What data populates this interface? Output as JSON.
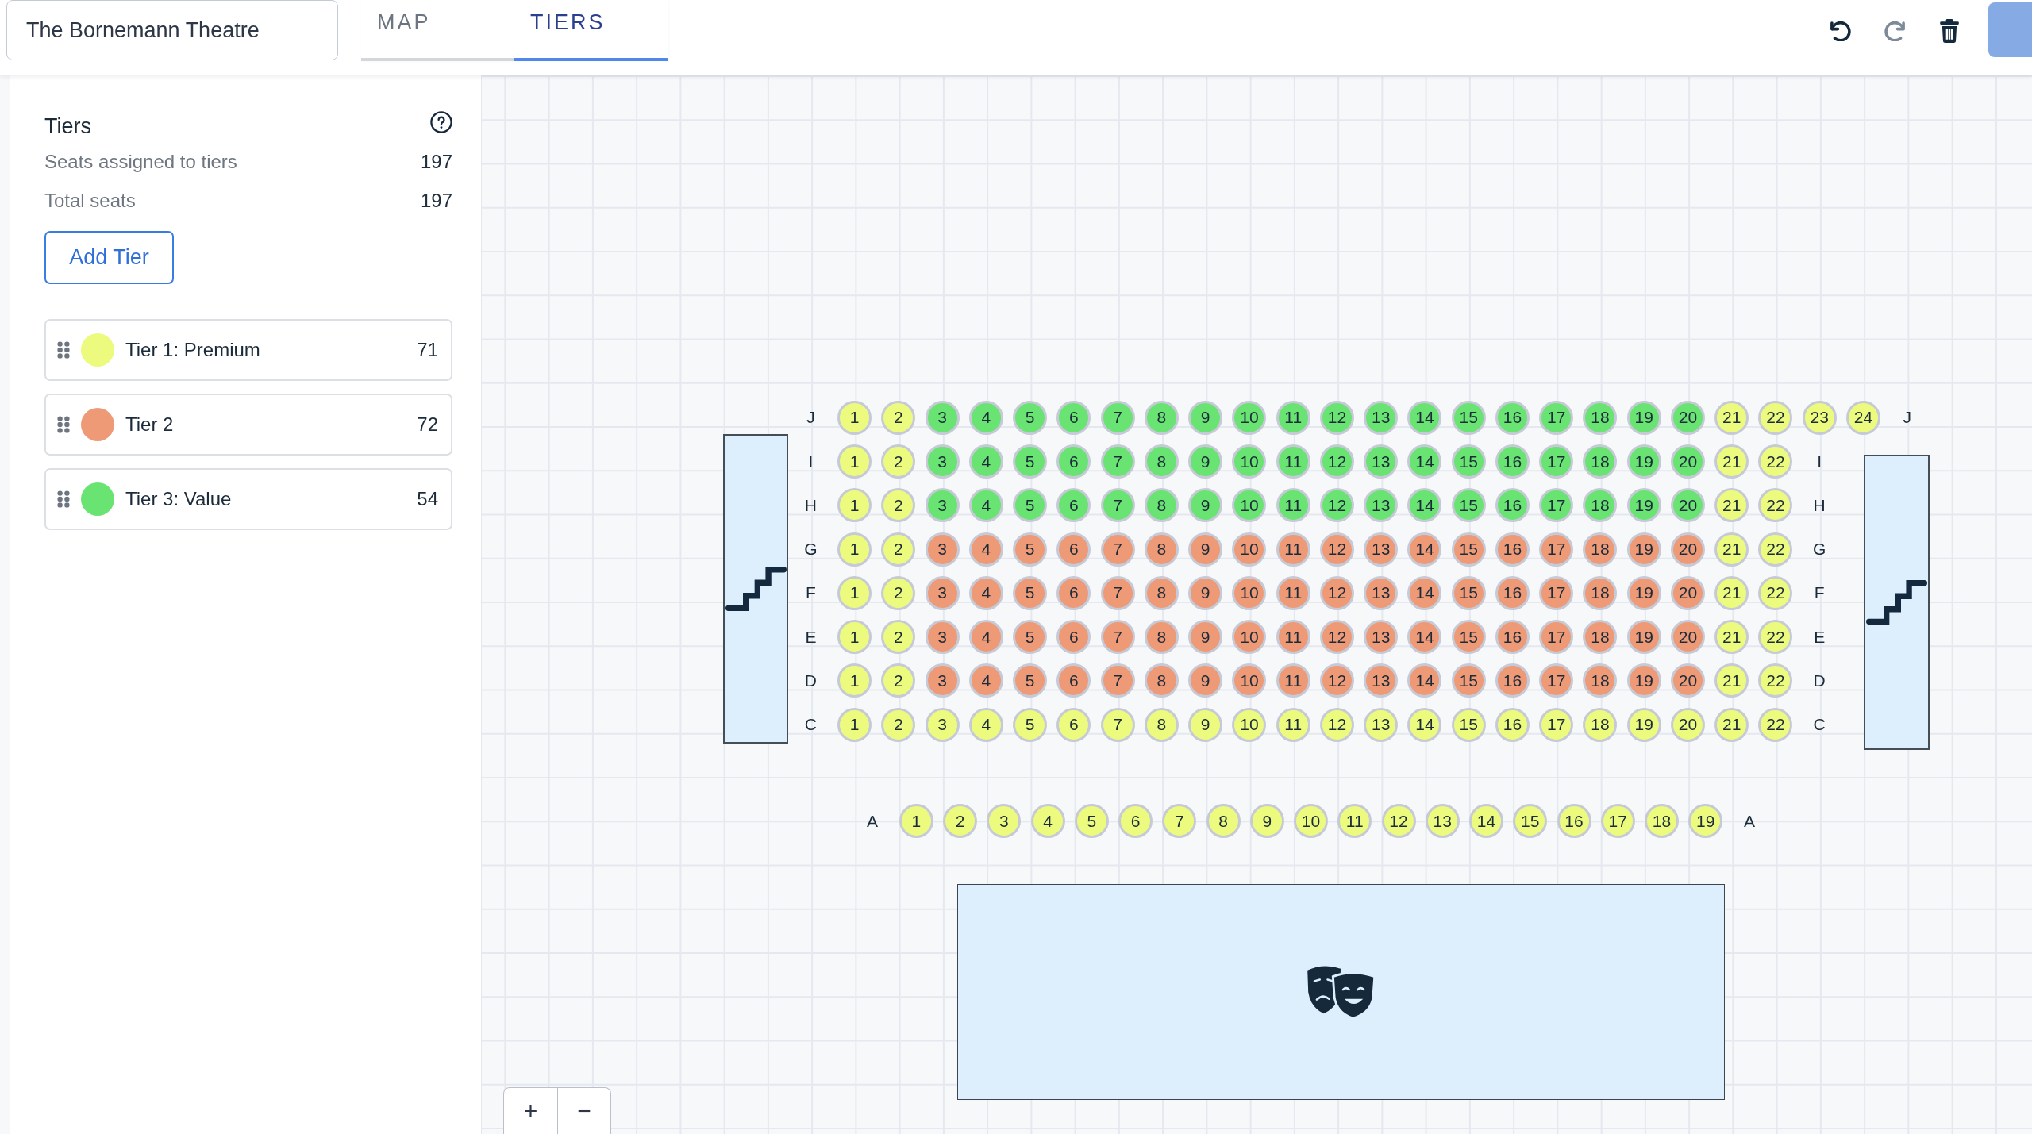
{
  "header": {
    "venue_name": "The Bornemann Theatre",
    "tabs": [
      {
        "label": "MAP",
        "selected": false
      },
      {
        "label": "TIERS",
        "selected": true
      }
    ]
  },
  "toolbar": [
    {
      "kind": "undo",
      "disabled": false
    },
    {
      "kind": "redo",
      "disabled": true
    },
    {
      "kind": "delete",
      "disabled": false
    }
  ],
  "tiers_panel": {
    "title": "Tiers",
    "stats": [
      {
        "label": "Seats assigned to tiers",
        "value": "197"
      },
      {
        "label": "Total seats",
        "value": "197"
      }
    ],
    "add_button": "Add Tier",
    "tiers": [
      {
        "name": "Tier 1: Premium",
        "count": "71",
        "color": "#ecfb7e"
      },
      {
        "name": "Tier 2",
        "count": "72",
        "color": "#ef9a77"
      },
      {
        "name": "Tier 3: Value",
        "count": "54",
        "color": "#69e372"
      }
    ]
  },
  "seat_map": {
    "rows": [
      {
        "label_left": "J",
        "label_right": "J",
        "seats": [
          {
            "number": "1",
            "color": "#ecfb7e"
          },
          {
            "number": "2",
            "color": "#ecfb7e"
          },
          {
            "number": "3",
            "color": "#69e372"
          },
          {
            "number": "4",
            "color": "#69e372"
          },
          {
            "number": "5",
            "color": "#69e372"
          },
          {
            "number": "6",
            "color": "#69e372"
          },
          {
            "number": "7",
            "color": "#69e372"
          },
          {
            "number": "8",
            "color": "#69e372"
          },
          {
            "number": "9",
            "color": "#69e372"
          },
          {
            "number": "10",
            "color": "#69e372"
          },
          {
            "number": "11",
            "color": "#69e372"
          },
          {
            "number": "12",
            "color": "#69e372"
          },
          {
            "number": "13",
            "color": "#69e372"
          },
          {
            "number": "14",
            "color": "#69e372"
          },
          {
            "number": "15",
            "color": "#69e372"
          },
          {
            "number": "16",
            "color": "#69e372"
          },
          {
            "number": "17",
            "color": "#69e372"
          },
          {
            "number": "18",
            "color": "#69e372"
          },
          {
            "number": "19",
            "color": "#69e372"
          },
          {
            "number": "20",
            "color": "#69e372"
          },
          {
            "number": "21",
            "color": "#ecfb7e"
          },
          {
            "number": "22",
            "color": "#ecfb7e"
          },
          {
            "number": "23",
            "color": "#ecfb7e"
          },
          {
            "number": "24",
            "color": "#ecfb7e"
          }
        ]
      },
      {
        "label_left": "I",
        "label_right": "I",
        "seats": [
          {
            "number": "1",
            "color": "#ecfb7e"
          },
          {
            "number": "2",
            "color": "#ecfb7e"
          },
          {
            "number": "3",
            "color": "#69e372"
          },
          {
            "number": "4",
            "color": "#69e372"
          },
          {
            "number": "5",
            "color": "#69e372"
          },
          {
            "number": "6",
            "color": "#69e372"
          },
          {
            "number": "7",
            "color": "#69e372"
          },
          {
            "number": "8",
            "color": "#69e372"
          },
          {
            "number": "9",
            "color": "#69e372"
          },
          {
            "number": "10",
            "color": "#69e372"
          },
          {
            "number": "11",
            "color": "#69e372"
          },
          {
            "number": "12",
            "color": "#69e372"
          },
          {
            "number": "13",
            "color": "#69e372"
          },
          {
            "number": "14",
            "color": "#69e372"
          },
          {
            "number": "15",
            "color": "#69e372"
          },
          {
            "number": "16",
            "color": "#69e372"
          },
          {
            "number": "17",
            "color": "#69e372"
          },
          {
            "number": "18",
            "color": "#69e372"
          },
          {
            "number": "19",
            "color": "#69e372"
          },
          {
            "number": "20",
            "color": "#69e372"
          },
          {
            "number": "21",
            "color": "#ecfb7e"
          },
          {
            "number": "22",
            "color": "#ecfb7e"
          }
        ]
      },
      {
        "label_left": "H",
        "label_right": "H",
        "seats": [
          {
            "number": "1",
            "color": "#ecfb7e"
          },
          {
            "number": "2",
            "color": "#ecfb7e"
          },
          {
            "number": "3",
            "color": "#69e372"
          },
          {
            "number": "4",
            "color": "#69e372"
          },
          {
            "number": "5",
            "color": "#69e372"
          },
          {
            "number": "6",
            "color": "#69e372"
          },
          {
            "number": "7",
            "color": "#69e372"
          },
          {
            "number": "8",
            "color": "#69e372"
          },
          {
            "number": "9",
            "color": "#69e372"
          },
          {
            "number": "10",
            "color": "#69e372"
          },
          {
            "number": "11",
            "color": "#69e372"
          },
          {
            "number": "12",
            "color": "#69e372"
          },
          {
            "number": "13",
            "color": "#69e372"
          },
          {
            "number": "14",
            "color": "#69e372"
          },
          {
            "number": "15",
            "color": "#69e372"
          },
          {
            "number": "16",
            "color": "#69e372"
          },
          {
            "number": "17",
            "color": "#69e372"
          },
          {
            "number": "18",
            "color": "#69e372"
          },
          {
            "number": "19",
            "color": "#69e372"
          },
          {
            "number": "20",
            "color": "#69e372"
          },
          {
            "number": "21",
            "color": "#ecfb7e"
          },
          {
            "number": "22",
            "color": "#ecfb7e"
          }
        ]
      },
      {
        "label_left": "G",
        "label_right": "G",
        "seats": [
          {
            "number": "1",
            "color": "#ecfb7e"
          },
          {
            "number": "2",
            "color": "#ecfb7e"
          },
          {
            "number": "3",
            "color": "#ef9a77"
          },
          {
            "number": "4",
            "color": "#ef9a77"
          },
          {
            "number": "5",
            "color": "#ef9a77"
          },
          {
            "number": "6",
            "color": "#ef9a77"
          },
          {
            "number": "7",
            "color": "#ef9a77"
          },
          {
            "number": "8",
            "color": "#ef9a77"
          },
          {
            "number": "9",
            "color": "#ef9a77"
          },
          {
            "number": "10",
            "color": "#ef9a77"
          },
          {
            "number": "11",
            "color": "#ef9a77"
          },
          {
            "number": "12",
            "color": "#ef9a77"
          },
          {
            "number": "13",
            "color": "#ef9a77"
          },
          {
            "number": "14",
            "color": "#ef9a77"
          },
          {
            "number": "15",
            "color": "#ef9a77"
          },
          {
            "number": "16",
            "color": "#ef9a77"
          },
          {
            "number": "17",
            "color": "#ef9a77"
          },
          {
            "number": "18",
            "color": "#ef9a77"
          },
          {
            "number": "19",
            "color": "#ef9a77"
          },
          {
            "number": "20",
            "color": "#ef9a77"
          },
          {
            "number": "21",
            "color": "#ecfb7e"
          },
          {
            "number": "22",
            "color": "#ecfb7e"
          }
        ]
      },
      {
        "label_left": "F",
        "label_right": "F",
        "seats": [
          {
            "number": "1",
            "color": "#ecfb7e"
          },
          {
            "number": "2",
            "color": "#ecfb7e"
          },
          {
            "number": "3",
            "color": "#ef9a77"
          },
          {
            "number": "4",
            "color": "#ef9a77"
          },
          {
            "number": "5",
            "color": "#ef9a77"
          },
          {
            "number": "6",
            "color": "#ef9a77"
          },
          {
            "number": "7",
            "color": "#ef9a77"
          },
          {
            "number": "8",
            "color": "#ef9a77"
          },
          {
            "number": "9",
            "color": "#ef9a77"
          },
          {
            "number": "10",
            "color": "#ef9a77"
          },
          {
            "number": "11",
            "color": "#ef9a77"
          },
          {
            "number": "12",
            "color": "#ef9a77"
          },
          {
            "number": "13",
            "color": "#ef9a77"
          },
          {
            "number": "14",
            "color": "#ef9a77"
          },
          {
            "number": "15",
            "color": "#ef9a77"
          },
          {
            "number": "16",
            "color": "#ef9a77"
          },
          {
            "number": "17",
            "color": "#ef9a77"
          },
          {
            "number": "18",
            "color": "#ef9a77"
          },
          {
            "number": "19",
            "color": "#ef9a77"
          },
          {
            "number": "20",
            "color": "#ef9a77"
          },
          {
            "number": "21",
            "color": "#ecfb7e"
          },
          {
            "number": "22",
            "color": "#ecfb7e"
          }
        ]
      },
      {
        "label_left": "E",
        "label_right": "E",
        "seats": [
          {
            "number": "1",
            "color": "#ecfb7e"
          },
          {
            "number": "2",
            "color": "#ecfb7e"
          },
          {
            "number": "3",
            "color": "#ef9a77"
          },
          {
            "number": "4",
            "color": "#ef9a77"
          },
          {
            "number": "5",
            "color": "#ef9a77"
          },
          {
            "number": "6",
            "color": "#ef9a77"
          },
          {
            "number": "7",
            "color": "#ef9a77"
          },
          {
            "number": "8",
            "color": "#ef9a77"
          },
          {
            "number": "9",
            "color": "#ef9a77"
          },
          {
            "number": "10",
            "color": "#ef9a77"
          },
          {
            "number": "11",
            "color": "#ef9a77"
          },
          {
            "number": "12",
            "color": "#ef9a77"
          },
          {
            "number": "13",
            "color": "#ef9a77"
          },
          {
            "number": "14",
            "color": "#ef9a77"
          },
          {
            "number": "15",
            "color": "#ef9a77"
          },
          {
            "number": "16",
            "color": "#ef9a77"
          },
          {
            "number": "17",
            "color": "#ef9a77"
          },
          {
            "number": "18",
            "color": "#ef9a77"
          },
          {
            "number": "19",
            "color": "#ef9a77"
          },
          {
            "number": "20",
            "color": "#ef9a77"
          },
          {
            "number": "21",
            "color": "#ecfb7e"
          },
          {
            "number": "22",
            "color": "#ecfb7e"
          }
        ]
      },
      {
        "label_left": "D",
        "label_right": "D",
        "seats": [
          {
            "number": "1",
            "color": "#ecfb7e"
          },
          {
            "number": "2",
            "color": "#ecfb7e"
          },
          {
            "number": "3",
            "color": "#ef9a77"
          },
          {
            "number": "4",
            "color": "#ef9a77"
          },
          {
            "number": "5",
            "color": "#ef9a77"
          },
          {
            "number": "6",
            "color": "#ef9a77"
          },
          {
            "number": "7",
            "color": "#ef9a77"
          },
          {
            "number": "8",
            "color": "#ef9a77"
          },
          {
            "number": "9",
            "color": "#ef9a77"
          },
          {
            "number": "10",
            "color": "#ef9a77"
          },
          {
            "number": "11",
            "color": "#ef9a77"
          },
          {
            "number": "12",
            "color": "#ef9a77"
          },
          {
            "number": "13",
            "color": "#ef9a77"
          },
          {
            "number": "14",
            "color": "#ef9a77"
          },
          {
            "number": "15",
            "color": "#ef9a77"
          },
          {
            "number": "16",
            "color": "#ef9a77"
          },
          {
            "number": "17",
            "color": "#ef9a77"
          },
          {
            "number": "18",
            "color": "#ef9a77"
          },
          {
            "number": "19",
            "color": "#ef9a77"
          },
          {
            "number": "20",
            "color": "#ef9a77"
          },
          {
            "number": "21",
            "color": "#ecfb7e"
          },
          {
            "number": "22",
            "color": "#ecfb7e"
          }
        ]
      },
      {
        "label_left": "C",
        "label_right": "C",
        "seats": [
          {
            "number": "1",
            "color": "#ecfb7e"
          },
          {
            "number": "2",
            "color": "#ecfb7e"
          },
          {
            "number": "3",
            "color": "#ecfb7e"
          },
          {
            "number": "4",
            "color": "#ecfb7e"
          },
          {
            "number": "5",
            "color": "#ecfb7e"
          },
          {
            "number": "6",
            "color": "#ecfb7e"
          },
          {
            "number": "7",
            "color": "#ecfb7e"
          },
          {
            "number": "8",
            "color": "#ecfb7e"
          },
          {
            "number": "9",
            "color": "#ecfb7e"
          },
          {
            "number": "10",
            "color": "#ecfb7e"
          },
          {
            "number": "11",
            "color": "#ecfb7e"
          },
          {
            "number": "12",
            "color": "#ecfb7e"
          },
          {
            "number": "13",
            "color": "#ecfb7e"
          },
          {
            "number": "14",
            "color": "#ecfb7e"
          },
          {
            "number": "15",
            "color": "#ecfb7e"
          },
          {
            "number": "16",
            "color": "#ecfb7e"
          },
          {
            "number": "17",
            "color": "#ecfb7e"
          },
          {
            "number": "18",
            "color": "#ecfb7e"
          },
          {
            "number": "19",
            "color": "#ecfb7e"
          },
          {
            "number": "20",
            "color": "#ecfb7e"
          },
          {
            "number": "21",
            "color": "#ecfb7e"
          },
          {
            "number": "22",
            "color": "#ecfb7e"
          }
        ]
      }
    ],
    "front_rows": [
      {
        "label_left": "A",
        "label_right": "A",
        "seats": [
          {
            "number": "1",
            "color": "#ecfb7e"
          },
          {
            "number": "2",
            "color": "#ecfb7e"
          },
          {
            "number": "3",
            "color": "#ecfb7e"
          },
          {
            "number": "4",
            "color": "#ecfb7e"
          },
          {
            "number": "5",
            "color": "#ecfb7e"
          },
          {
            "number": "6",
            "color": "#ecfb7e"
          },
          {
            "number": "7",
            "color": "#ecfb7e"
          },
          {
            "number": "8",
            "color": "#ecfb7e"
          },
          {
            "number": "9",
            "color": "#ecfb7e"
          },
          {
            "number": "10",
            "color": "#ecfb7e"
          },
          {
            "number": "11",
            "color": "#ecfb7e"
          },
          {
            "number": "12",
            "color": "#ecfb7e"
          },
          {
            "number": "13",
            "color": "#ecfb7e"
          },
          {
            "number": "14",
            "color": "#ecfb7e"
          },
          {
            "number": "15",
            "color": "#ecfb7e"
          },
          {
            "number": "16",
            "color": "#ecfb7e"
          },
          {
            "number": "17",
            "color": "#ecfb7e"
          },
          {
            "number": "18",
            "color": "#ecfb7e"
          },
          {
            "number": "19",
            "color": "#ecfb7e"
          }
        ]
      }
    ]
  },
  "zoom_controls": [
    "+",
    "−"
  ]
}
